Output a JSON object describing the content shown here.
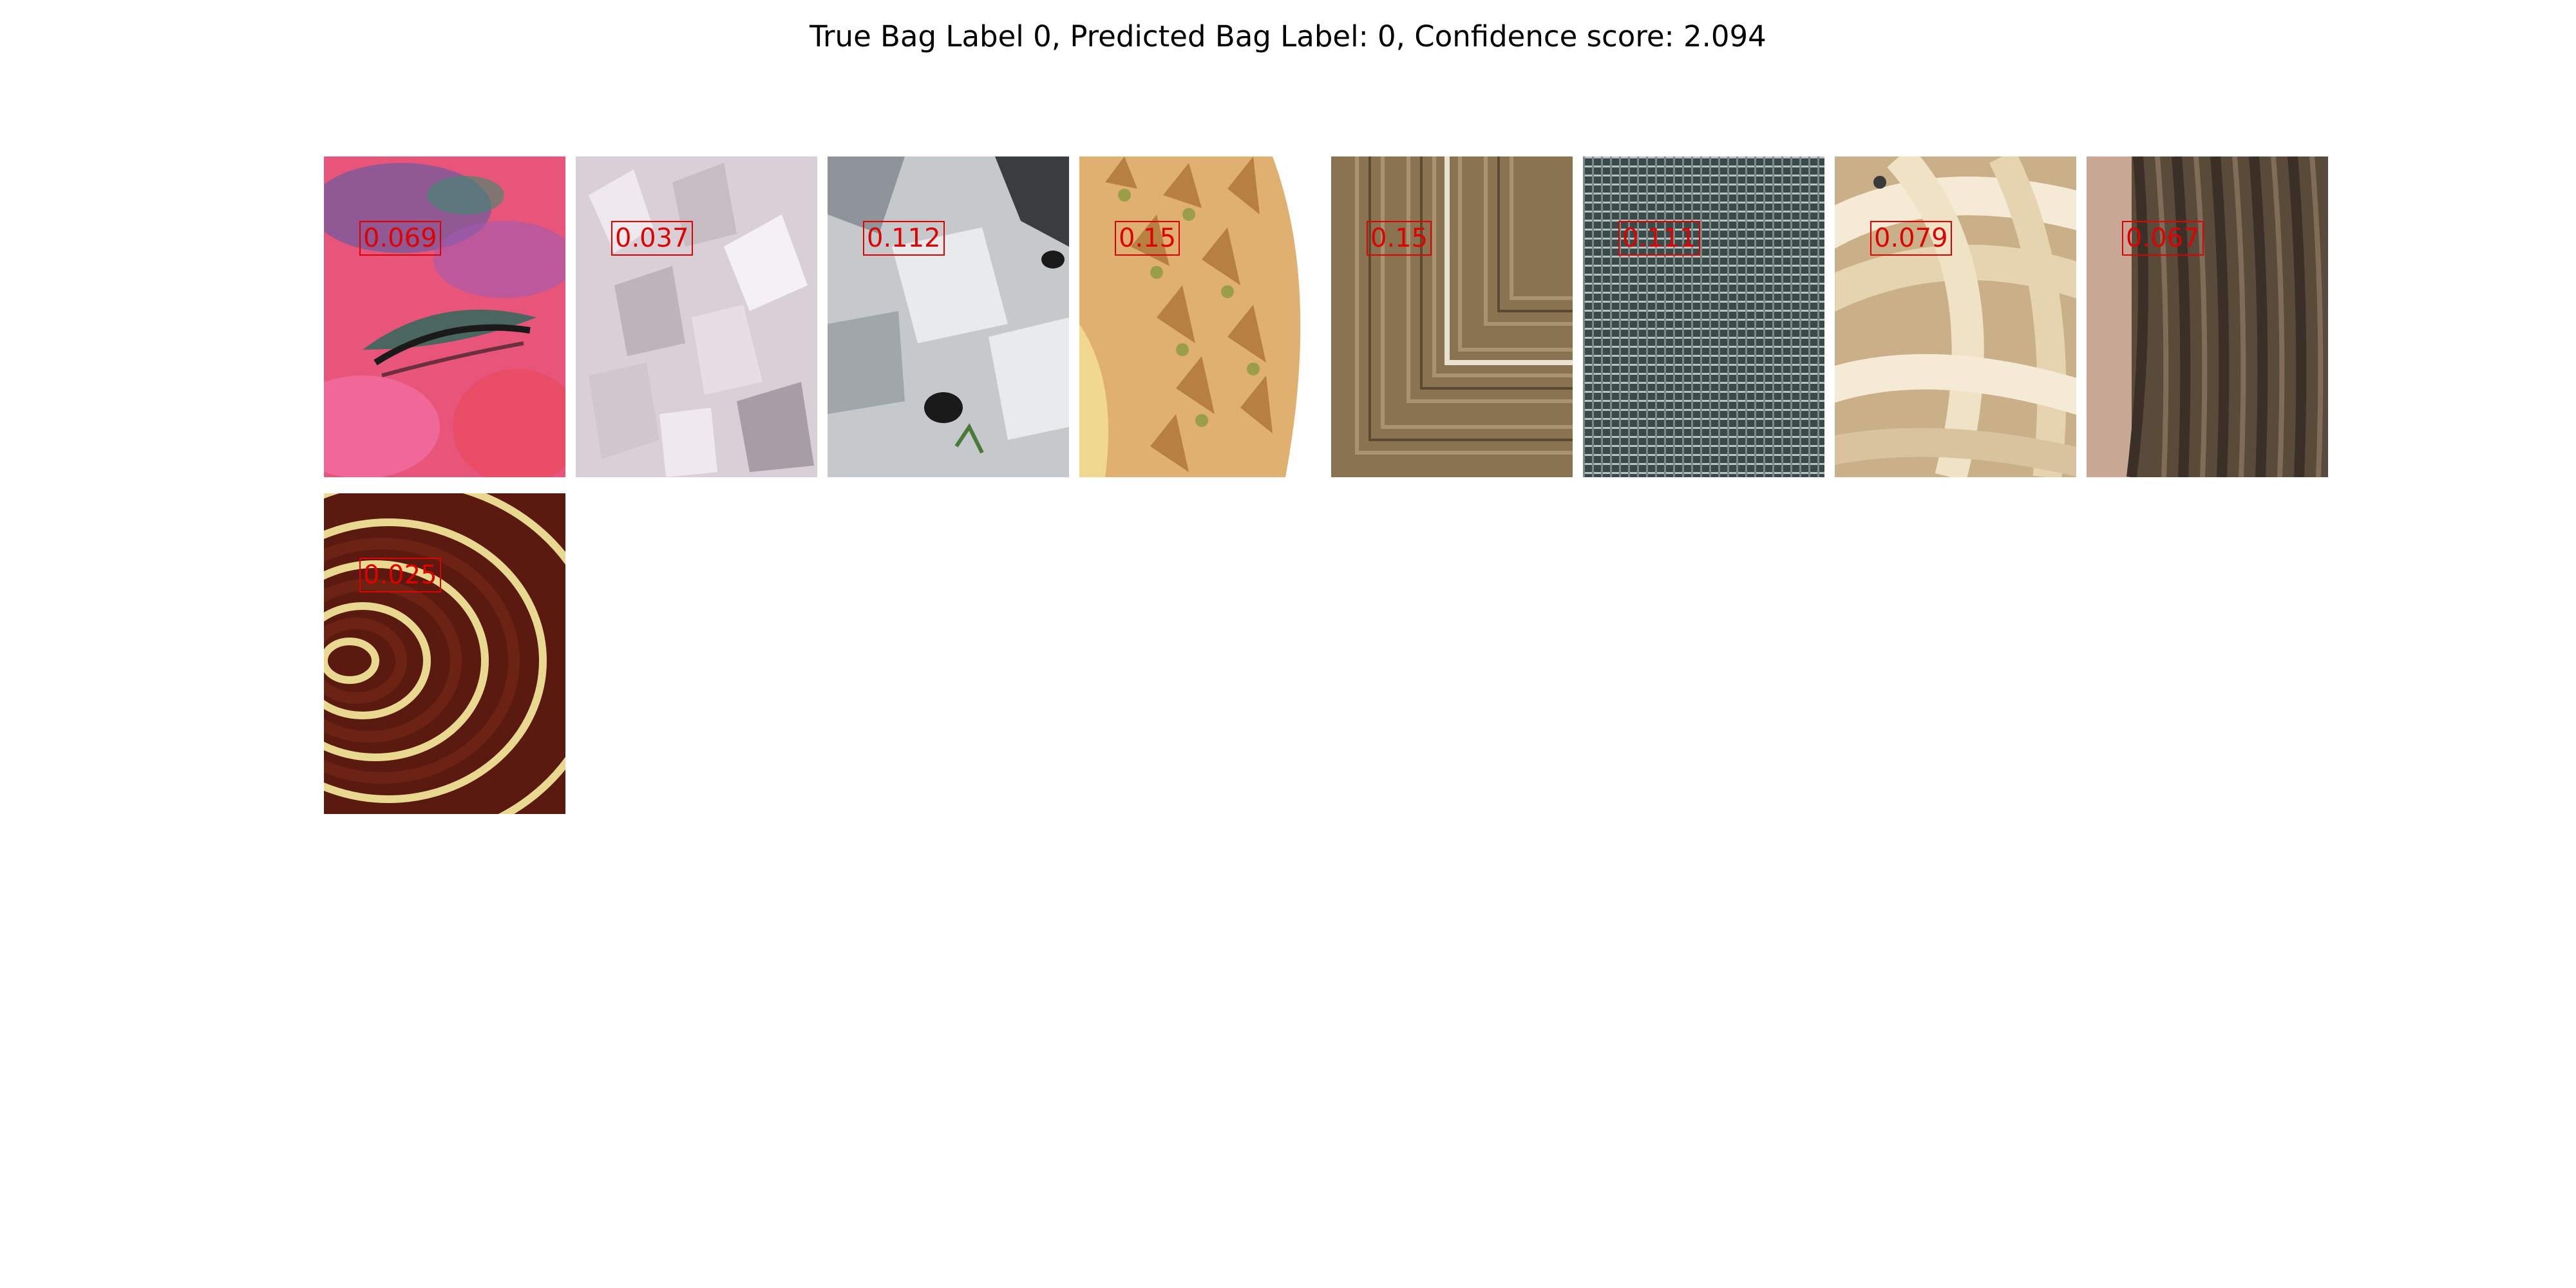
{
  "title": "True Bag Label 0, Predicted Bag Label: 0, Confidence score: 2.094",
  "instances": [
    {
      "texture": "colored-powder-eye",
      "score": "0.069",
      "colors": [
        "#e8557a",
        "#7a5a9a",
        "#2f6a5a",
        "#f06a9a"
      ]
    },
    {
      "texture": "white-crystals",
      "score": "0.037",
      "colors": [
        "#d8d0d6",
        "#bfb3bb",
        "#efe9ee",
        "#a89ca6"
      ]
    },
    {
      "texture": "grey-rock",
      "score": "0.112",
      "colors": [
        "#c5c9cc",
        "#8e9499",
        "#e8eaeb",
        "#3a3d40"
      ]
    },
    {
      "texture": "durian-spikes",
      "score": "0.15",
      "colors": [
        "#e0b070",
        "#b88040",
        "#8a9a40",
        "#f0d890"
      ]
    },
    {
      "texture": "woven-mat-corner",
      "score": "0.15",
      "colors": [
        "#8a7350",
        "#a89270",
        "#5a4a30",
        "#e8e0d0"
      ]
    },
    {
      "texture": "wire-mesh",
      "score": "0.111",
      "colors": [
        "#3a4a48",
        "#7a8a88",
        "#b8c4c2",
        "#1f2a29"
      ]
    },
    {
      "texture": "braided-wicker",
      "score": "0.079",
      "colors": [
        "#e6d4b0",
        "#c9b088",
        "#f4ead6",
        "#9a8060"
      ]
    },
    {
      "texture": "dreadlocks-hair",
      "score": "0.067",
      "colors": [
        "#5a4a3a",
        "#3a3028",
        "#8a7560",
        "#c8a894"
      ]
    },
    {
      "texture": "wood-rings-spiral",
      "score": "0.025",
      "colors": [
        "#5a1a10",
        "#7a2a18",
        "#e8d890",
        "#f4f0c0"
      ]
    }
  ]
}
